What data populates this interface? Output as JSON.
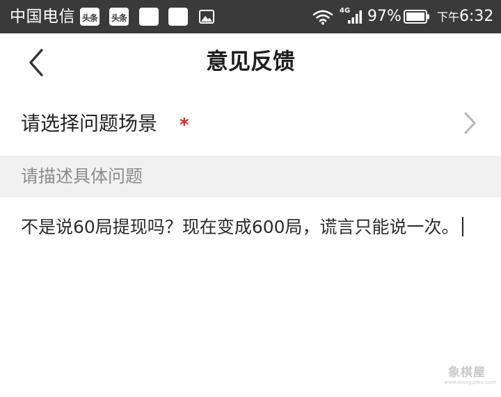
{
  "status_bar": {
    "carrier": "中国电信",
    "notification_icons": [
      "toutiao-icon",
      "toutiao-icon",
      "blank-square-icon",
      "blank-square-icon",
      "image-icon"
    ],
    "toutiao_label": "头条",
    "network": "4G",
    "battery_percent": "97%",
    "time_period": "下午",
    "time": "6:32"
  },
  "header": {
    "title": "意见反馈",
    "back_icon": "chevron-left-icon"
  },
  "form": {
    "scene_label": "请选择问题场景",
    "required_mark": "*",
    "scene_icon": "chevron-right-icon",
    "description_header": "请描述具体问题",
    "description_value": "不是说60局提现吗？现在变成600局，谎言只能说一次。"
  },
  "watermark": {
    "text": "象棋屋",
    "subtext": "www.xiangqiwu.com"
  },
  "colors": {
    "status_bar_bg": "#3a3a3a",
    "required": "#e02020",
    "section_bg": "#f1f1f1",
    "placeholder_text": "#8c8c8c"
  }
}
